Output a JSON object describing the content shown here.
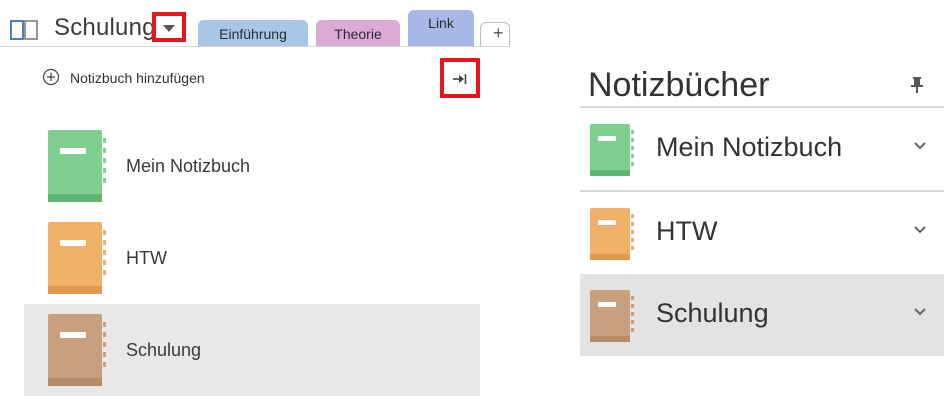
{
  "colors": {
    "highlight_box": "#e8141c",
    "tab_einfuehrung": "#a8c6e6",
    "tab_theorie": "#dcaad4",
    "tab_link": "#a7b8e8",
    "notebook_green": "#7ecf90",
    "notebook_orange": "#f0b06a",
    "notebook_brown": "#c9a07e",
    "selected_row": "#e8e8e8"
  },
  "left_panel": {
    "current_notebook": "Schulung",
    "current_notebook_icon": "notebook-outline-icon",
    "dropdown_icon": "chevron-down-icon",
    "tabs": [
      {
        "label": "Einführung"
      },
      {
        "label": "Theorie"
      },
      {
        "label": "Link"
      }
    ],
    "new_tab_icon": "plus-icon",
    "add_notebook_label": "Notizbuch hinzufügen",
    "add_notebook_icon": "plus-circle-icon",
    "pin_icon": "pin-icon",
    "notebooks": [
      {
        "label": "Mein Notizbuch",
        "color": "green",
        "selected": false
      },
      {
        "label": "HTW",
        "color": "orange",
        "selected": false
      },
      {
        "label": "Schulung",
        "color": "brown",
        "selected": true
      }
    ]
  },
  "right_panel": {
    "title": "Notizbücher",
    "pin_icon": "pushpin-icon",
    "notebooks": [
      {
        "label": "Mein Notizbuch",
        "color": "green",
        "selected": false
      },
      {
        "label": "HTW",
        "color": "orange",
        "selected": false
      },
      {
        "label": "Schulung",
        "color": "brown",
        "selected": true
      }
    ]
  }
}
